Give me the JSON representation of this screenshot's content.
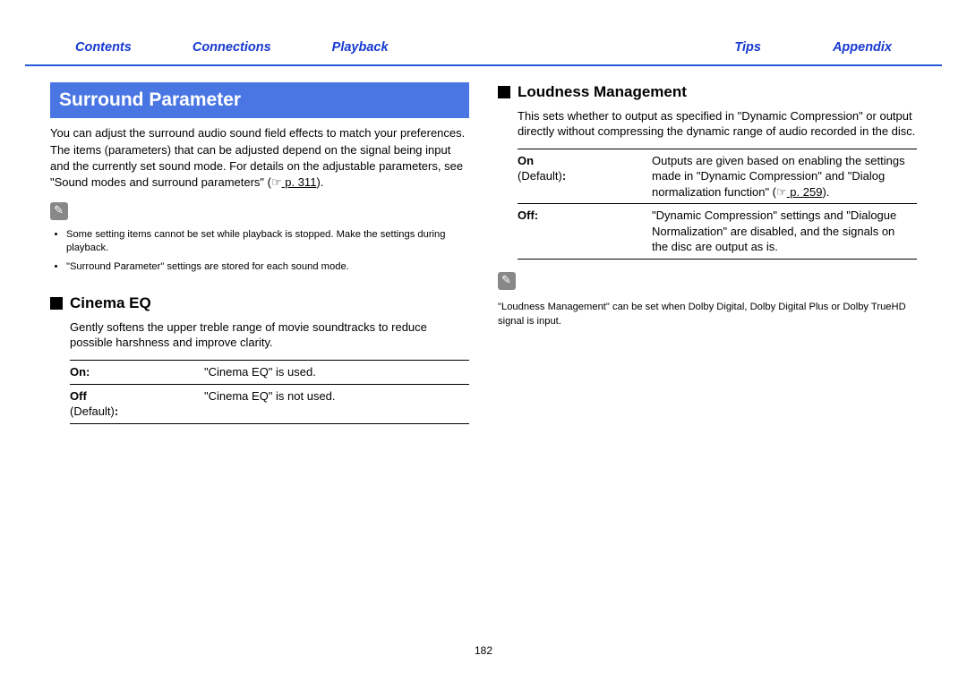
{
  "nav": {
    "contents": "Contents",
    "connections": "Connections",
    "playback": "Playback",
    "tips": "Tips",
    "appendix": "Appendix"
  },
  "left": {
    "banner": "Surround Parameter",
    "intro1": "You can adjust the surround audio sound field effects to match your preferences.",
    "intro2a": "The items (parameters) that can be adjusted depend on the signal being input and the currently set sound mode. For details on the adjustable parameters, see \"Sound modes and surround parameters\" (",
    "intro2_linktext": " p. 311",
    "intro2b": ").",
    "note1": "Some setting items cannot be set while playback is stopped. Make the settings during playback.",
    "note2": "\"Surround Parameter\" settings are stored for each sound mode.",
    "cinema_eq_h": "Cinema EQ",
    "cinema_eq_desc": "Gently softens the upper treble range of movie soundtracks to reduce possible harshness and improve clarity.",
    "cinema_eq_on_key": "On:",
    "cinema_eq_on_val": "\"Cinema EQ\" is used.",
    "cinema_eq_off_key": "Off",
    "cinema_eq_off_meta": "(Default)",
    "cinema_eq_off_colon": ":",
    "cinema_eq_off_val": "\"Cinema EQ\" is not used."
  },
  "right": {
    "lm_h": "Loudness Management",
    "lm_desc": "This sets whether to output as specified in \"Dynamic Compression\" or output directly without compressing the dynamic range of audio recorded in the disc.",
    "lm_on_key": "On",
    "lm_on_meta": "(Default)",
    "lm_on_colon": ":",
    "lm_on_val_a": "Outputs are given based on enabling the settings made in \"Dynamic Compression\" and \"Dialog normalization function\" (",
    "lm_on_link": " p. 259",
    "lm_on_val_b": ").",
    "lm_off_key": "Off:",
    "lm_off_val": "\"Dynamic Compression\" settings and \"Dialogue Normalization\" are disabled, and the signals on the disc are output as is.",
    "lm_note": "\"Loudness Management\" can be set when Dolby Digital, Dolby Digital Plus or Dolby TrueHD signal is input."
  },
  "page_number": "182",
  "icons": {
    "pointer": "☞"
  }
}
